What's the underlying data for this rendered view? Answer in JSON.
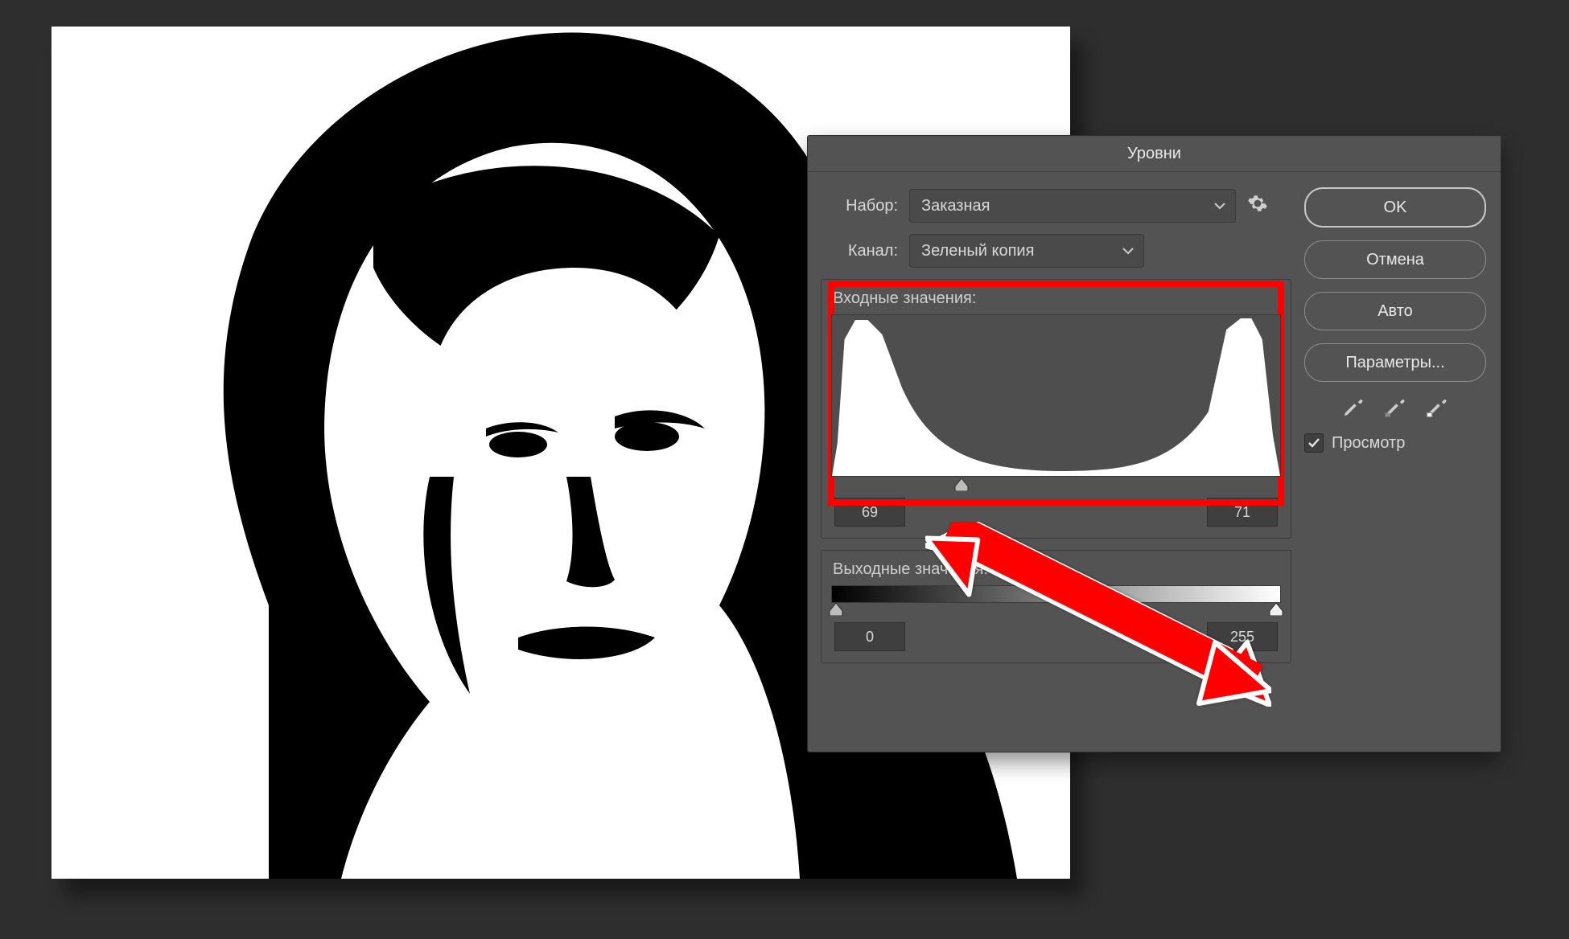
{
  "canvas": {
    "bg": "#ffffff"
  },
  "dialog": {
    "title": "Уровни",
    "preset": {
      "label": "Набор:",
      "value": "Заказная"
    },
    "channel": {
      "label": "Канал:",
      "value": "Зеленый копия"
    },
    "input_levels": {
      "title": "Входные значения:",
      "shadow": "69",
      "highlight": "71",
      "gamma_pos_pct": 29
    },
    "output_levels": {
      "title": "Выходные значения:",
      "black": "0",
      "white": "255"
    },
    "buttons": {
      "ok": "OK",
      "cancel": "Отмена",
      "auto": "Авто",
      "options": "Параметры..."
    },
    "preview": {
      "label": "Просмотр",
      "checked": true
    }
  },
  "annotation": {
    "highlight_color": "#ff0000"
  }
}
